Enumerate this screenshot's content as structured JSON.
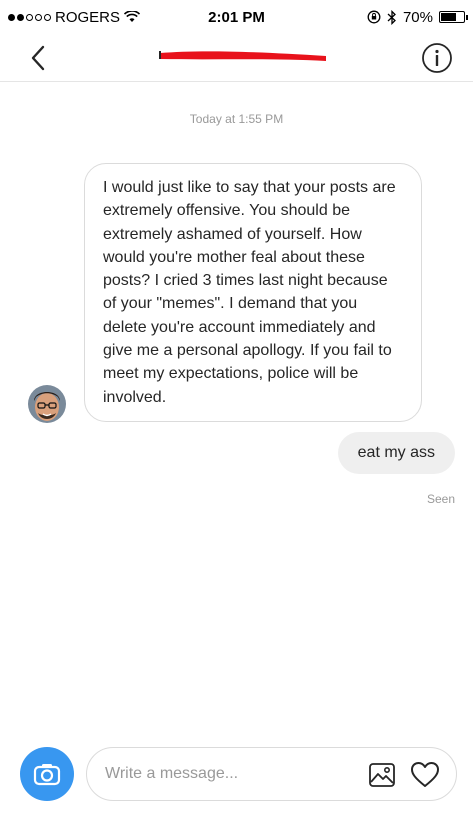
{
  "status_bar": {
    "carrier": "ROGERS",
    "time": "2:01 PM",
    "battery": "70%",
    "battery_level": 0.7
  },
  "header": {
    "title": "",
    "icons": [
      "back-chevron-icon",
      "info-icon"
    ],
    "redaction_color": "#e8121b"
  },
  "conversation": {
    "timestamp": "Today at 1:55 PM",
    "incoming": [
      {
        "text": "I would just like to say that your posts are extremely offensive. You should be extremely ashamed of yourself. How would you're mother feal about these posts? I cried 3 times last night because of your \"memes\". I demand that you delete you're account immediately and give me a personal apollogy. If you fail to meet my expectations, police will be involved."
      }
    ],
    "outgoing": [
      {
        "text": "eat my ass"
      }
    ],
    "seen_label": "Seen"
  },
  "composer": {
    "placeholder": "Write a message...",
    "value": "",
    "icons": [
      "camera-icon",
      "gallery-icon",
      "heart-icon"
    ]
  },
  "colors": {
    "accent": "#3897f0",
    "bubble_border": "#dbdbdb",
    "bubble_out_bg": "#efefef",
    "muted_text": "#999999"
  }
}
